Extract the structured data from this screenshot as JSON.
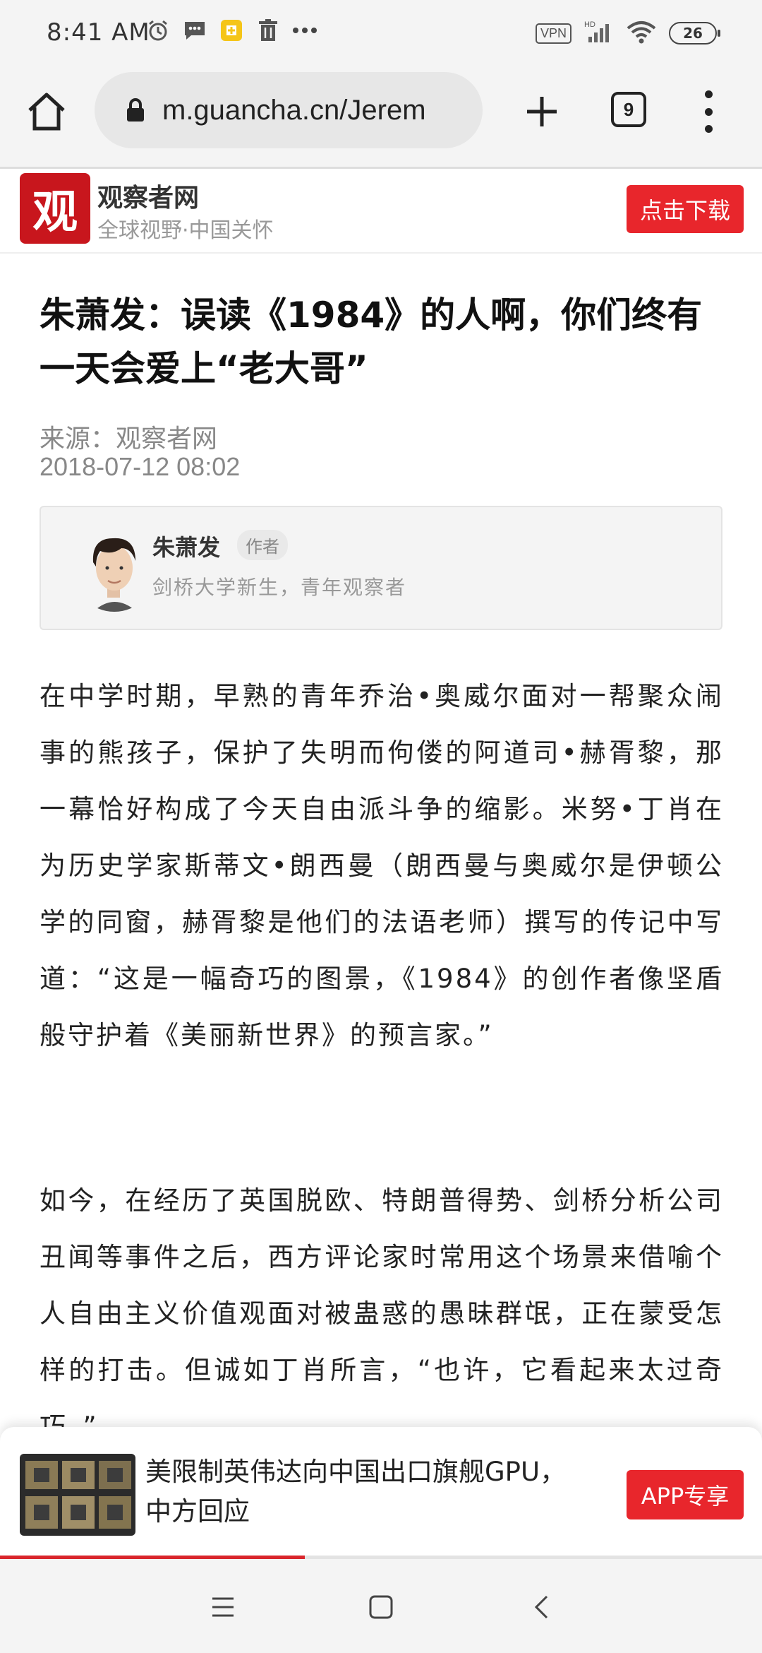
{
  "status_bar": {
    "time": "8:41 AM",
    "vpn": "VPN",
    "battery": "26"
  },
  "browser": {
    "url": "m.guancha.cn/Jerem",
    "tab_count": "9"
  },
  "site": {
    "logo_char": "观",
    "name": "观察者网",
    "slogan": "全球视野·中国关怀",
    "download_label": "点击下载"
  },
  "article": {
    "title": "朱萧发：误读《1984》的人啊，你们终有一天会爱上“老大哥”",
    "source": "来源：观察者网",
    "date": "2018-07-12 08:02",
    "author": {
      "name": "朱萧发",
      "tag": "作者",
      "bio": "剑桥大学新生，青年观察者"
    },
    "paragraphs": [
      "在中学时期，早熟的青年乔治•奥威尔面对一帮聚众闹事的熊孩子，保护了失明而佝偻的阿道司•赫胥黎，那一幕恰好构成了今天自由派斗争的缩影。米努•丁肖在为历史学家斯蒂文•朗西曼（朗西曼与奥威尔是伊顿公学的同窗，赫胥黎是他们的法语老师）撰写的传记中写道：“这是一幅奇巧的图景，《1984》的创作者像坚盾般守护着《美丽新世界》的预言家。”",
      "如今，在经历了英国脱欧、特朗普得势、剑桥分析公司丑闻等事件之后，西方评论家时常用这个场景来借喻个人自由主义价值观面对被蛊惑的愚昧群氓，正在蒙受怎样的打击。但诚如丁肖所言，“也许，它看起来太过奇巧。”"
    ]
  },
  "recommendation": {
    "title": "美限制英伟达向中国出口旗舰GPU，中方回应",
    "button": "APP专享"
  },
  "reading_progress": 0.4
}
